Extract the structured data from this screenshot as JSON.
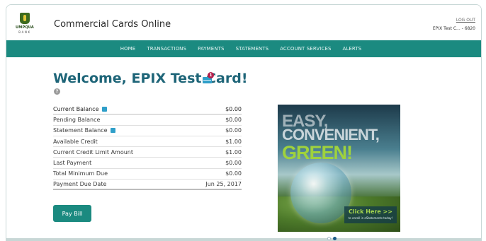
{
  "header": {
    "bank_name": "UMPQUA",
    "bank_sub": "BANK",
    "app_title": "Commercial Cards Online",
    "logout_label": "LOG OUT",
    "account_label": "EPIX Test C... - 6820"
  },
  "nav": {
    "items": [
      "HOME",
      "TRANSACTIONS",
      "PAYMENTS",
      "STATEMENTS",
      "ACCOUNT SERVICES",
      "ALERTS"
    ]
  },
  "welcome": {
    "title": "Welcome, EPIX Test Card!",
    "message_count": "1",
    "help_glyph": "?"
  },
  "balances": [
    {
      "label": "Current Balance",
      "value": "$0.00",
      "has_info_icon": true
    },
    {
      "label": "Pending Balance",
      "value": "$0.00",
      "has_info_icon": false
    },
    {
      "label": "Statement Balance",
      "value": "$0.00",
      "has_info_icon": true
    },
    {
      "label": "Available Credit",
      "value": "$1.00",
      "has_info_icon": false
    },
    {
      "label": "Current Credit Limit Amount",
      "value": "$1.00",
      "has_info_icon": false
    },
    {
      "label": "Last Payment",
      "value": "$0.00",
      "has_info_icon": false
    },
    {
      "label": "Total Minimum Due",
      "value": "$0.00",
      "has_info_icon": false
    },
    {
      "label": "Payment Due Date",
      "value": "Jun 25, 2017",
      "has_info_icon": false
    }
  ],
  "pay_button_label": "Pay Bill",
  "promo": {
    "line1": "EASY,",
    "line2": "CONVENIENT,",
    "line3": "GREEN!",
    "cta_title": "Click Here >>",
    "cta_sub": "to enroll in eStatements today!"
  },
  "carousel": {
    "count": 2,
    "active_index": 1
  },
  "colors": {
    "brand_teal": "#1b8a80",
    "heading_blue": "#1e6578",
    "badge_red": "#b41f4b",
    "info_blue": "#2f9fc9",
    "promo_green": "#9fd23d"
  },
  "icons": {
    "logo": "umpqua-bank-logo-icon",
    "messages": "envelope-icon",
    "help": "help-circle-icon",
    "info": "info-icon"
  }
}
